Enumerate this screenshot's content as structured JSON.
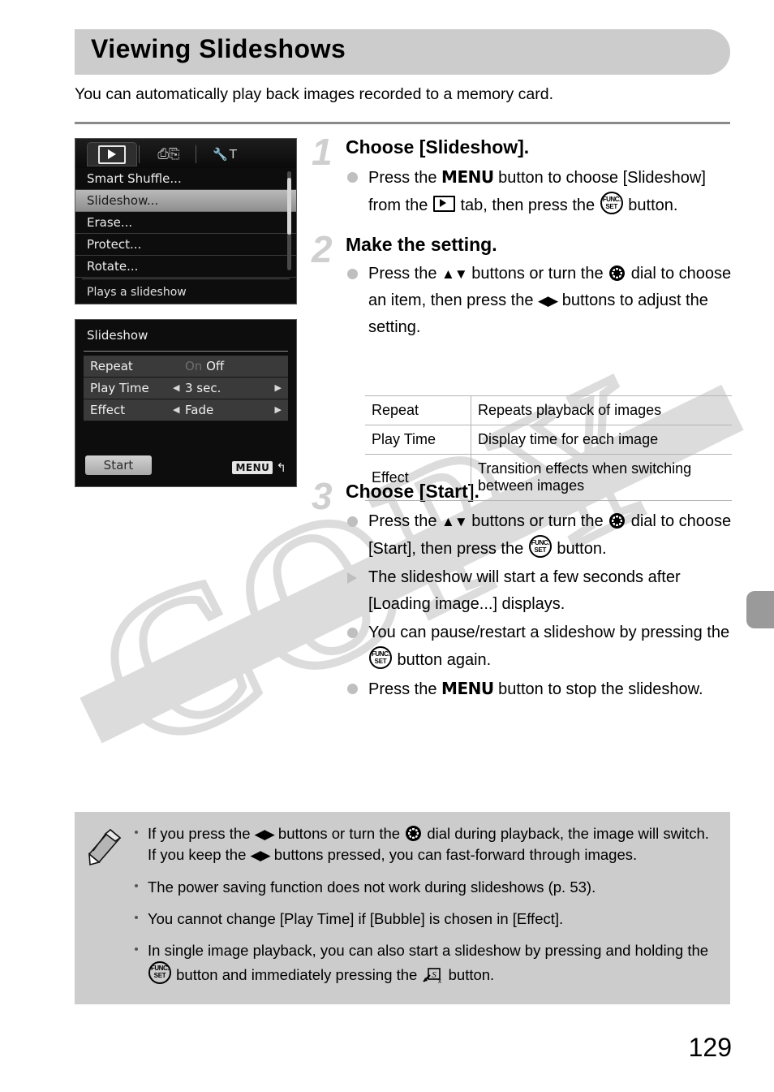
{
  "header": {
    "title": "Viewing Slideshows",
    "intro": "You can automatically play back images recorded to a memory card."
  },
  "watermark": {
    "text": "COPY"
  },
  "camera_screen_1": {
    "tabs": [
      {
        "icon": "playback-tab-icon",
        "selected": true
      },
      {
        "icon": "print-tab-icon",
        "selected": false
      },
      {
        "icon": "settings-tab-icon",
        "selected": false
      }
    ],
    "menu_items": [
      {
        "label": "Smart Shuffle...",
        "selected": false
      },
      {
        "label": "Slideshow...",
        "selected": true
      },
      {
        "label": "Erase...",
        "selected": false
      },
      {
        "label": "Protect...",
        "selected": false
      },
      {
        "label": "Rotate...",
        "selected": false
      }
    ],
    "hint": "Plays a slideshow"
  },
  "camera_screen_2": {
    "title": "Slideshow",
    "rows": [
      {
        "label": "Repeat",
        "value_off": "On",
        "value": "Off",
        "has_arrows": false
      },
      {
        "label": "Play Time",
        "value": "3 sec.",
        "has_arrows": true
      },
      {
        "label": "Effect",
        "value": "Fade",
        "has_arrows": true
      }
    ],
    "start_button": "Start",
    "menu_chip": "MENU",
    "menu_return": "↰"
  },
  "steps": [
    {
      "number": "1",
      "heading": "Choose [Slideshow].",
      "bullets": [
        {
          "marker": "dot",
          "parts": [
            {
              "t": "text",
              "v": "Press the "
            },
            {
              "t": "menu",
              "v": "MENU"
            },
            {
              "t": "text",
              "v": " button to choose [Slideshow] from the "
            },
            {
              "t": "play",
              "v": ""
            },
            {
              "t": "text",
              "v": " tab, then press the "
            },
            {
              "t": "func",
              "v": ""
            },
            {
              "t": "text",
              "v": " button."
            }
          ]
        }
      ]
    },
    {
      "number": "2",
      "heading": "Make the setting.",
      "bullets": [
        {
          "marker": "dot",
          "parts": [
            {
              "t": "text",
              "v": "Press the "
            },
            {
              "t": "updown",
              "v": "▲▼"
            },
            {
              "t": "text",
              "v": " buttons or turn the "
            },
            {
              "t": "dial",
              "v": ""
            },
            {
              "t": "text",
              "v": " dial to choose an item, then press the "
            },
            {
              "t": "leftright",
              "v": "◀▶"
            },
            {
              "t": "text",
              "v": " buttons to adjust the setting."
            }
          ]
        }
      ]
    },
    {
      "number": "3",
      "heading": "Choose [Start].",
      "bullets": [
        {
          "marker": "dot",
          "parts": [
            {
              "t": "text",
              "v": "Press the "
            },
            {
              "t": "updown",
              "v": "▲▼"
            },
            {
              "t": "text",
              "v": " buttons or turn the "
            },
            {
              "t": "dial",
              "v": ""
            },
            {
              "t": "text",
              "v": " dial to choose [Start], then press the "
            },
            {
              "t": "func",
              "v": ""
            },
            {
              "t": "text",
              "v": " button."
            }
          ]
        },
        {
          "marker": "triangle",
          "parts": [
            {
              "t": "text",
              "v": "The slideshow will start a few seconds after [Loading image...] displays."
            }
          ]
        },
        {
          "marker": "dot",
          "parts": [
            {
              "t": "text",
              "v": "You can pause/restart a slideshow by pressing the "
            },
            {
              "t": "func",
              "v": ""
            },
            {
              "t": "text",
              "v": " button again."
            }
          ]
        },
        {
          "marker": "dot",
          "parts": [
            {
              "t": "text",
              "v": "Press the "
            },
            {
              "t": "menu",
              "v": "MENU"
            },
            {
              "t": "text",
              "v": " button to stop the slideshow."
            }
          ]
        }
      ]
    }
  ],
  "settings_table": {
    "rows": [
      {
        "key": "Repeat",
        "desc": "Repeats playback of images"
      },
      {
        "key": "Play Time",
        "desc": "Display time for each image"
      },
      {
        "key": "Effect",
        "desc": "Transition effects when switching between images"
      }
    ]
  },
  "notes": {
    "icon": "pencil-icon",
    "items": [
      [
        {
          "t": "text",
          "v": "If you press the "
        },
        {
          "t": "leftright",
          "v": "◀▶"
        },
        {
          "t": "text",
          "v": " buttons or turn the "
        },
        {
          "t": "dial",
          "v": ""
        },
        {
          "t": "text",
          "v": " dial during playback, the image will switch. If you keep the "
        },
        {
          "t": "leftright",
          "v": "◀▶"
        },
        {
          "t": "text",
          "v": " buttons pressed, you can fast-forward through images."
        }
      ],
      [
        {
          "t": "text",
          "v": "The power saving function does not work during slideshows (p. 53)."
        }
      ],
      [
        {
          "t": "text",
          "v": "You cannot change [Play Time] if [Bubble] is chosen in [Effect]."
        }
      ],
      [
        {
          "t": "text",
          "v": "In single image playback, you can also start a slideshow by pressing and holding the "
        },
        {
          "t": "func",
          "v": ""
        },
        {
          "t": "text",
          "v": " button and immediately pressing the "
        },
        {
          "t": "jump",
          "v": ""
        },
        {
          "t": "text",
          "v": " button."
        }
      ]
    ]
  },
  "footer": {
    "page_number": "129"
  }
}
